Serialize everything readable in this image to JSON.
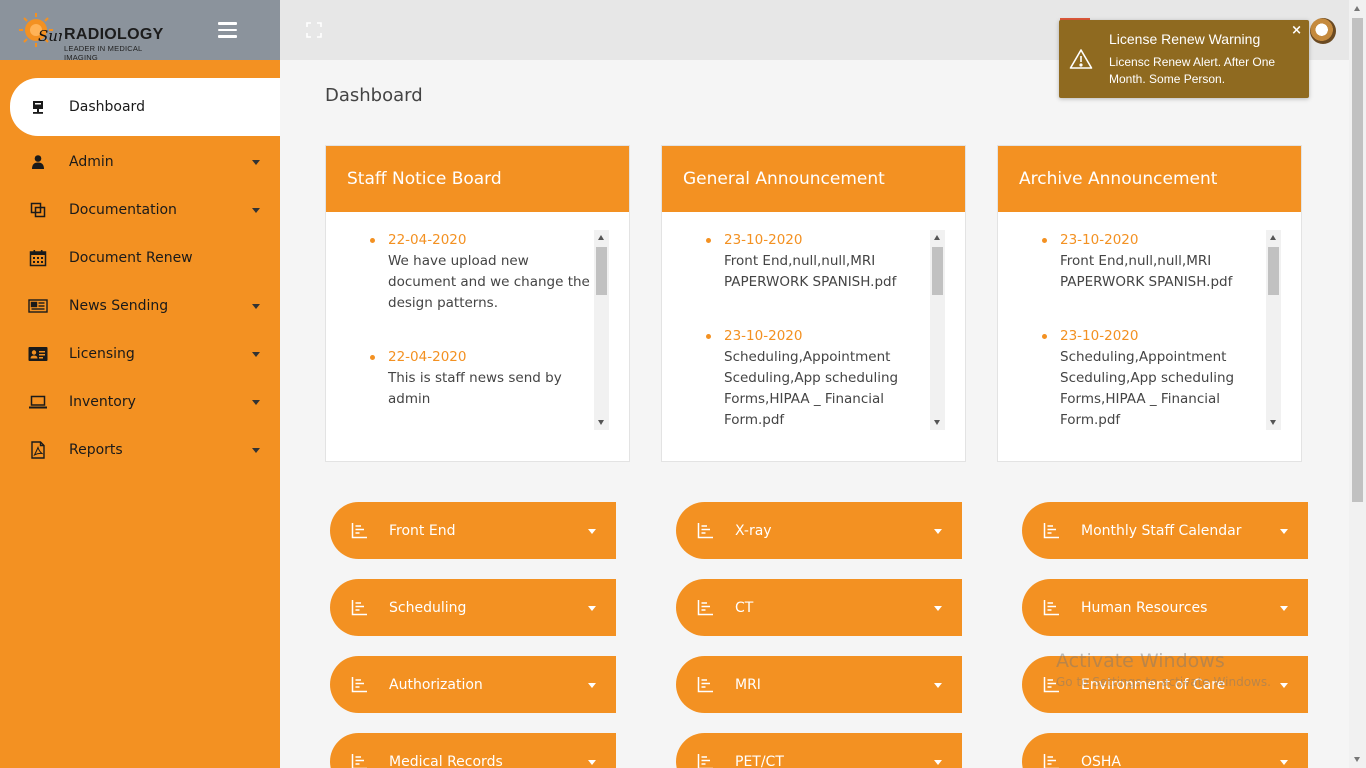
{
  "brand": {
    "logo_main": "RADIOLOGY",
    "logo_script": "Sun",
    "tagline": "LEADER IN MEDICAL IMAGING"
  },
  "sidebar": {
    "items": [
      {
        "label": "Dashboard",
        "icon": "monitor-icon",
        "active": true
      },
      {
        "label": "Admin",
        "icon": "user-icon"
      },
      {
        "label": "Documentation",
        "icon": "copy-icon"
      },
      {
        "label": "Document Renew",
        "icon": "calendar-icon"
      },
      {
        "label": "News Sending",
        "icon": "newspaper-icon"
      },
      {
        "label": "Licensing",
        "icon": "id-card-icon"
      },
      {
        "label": "Inventory",
        "icon": "laptop-icon"
      },
      {
        "label": "Reports",
        "icon": "pdf-file-icon"
      }
    ]
  },
  "toast": {
    "title": "License Renew Warning",
    "message": "Licensc Renew Alert. After One Month. Some Person.",
    "close": "×"
  },
  "page": {
    "title": "Dashboard"
  },
  "cards": [
    {
      "title": "Staff Notice Board",
      "items": [
        {
          "date": "22-04-2020",
          "text": "We have upload new document and we change the design patterns."
        },
        {
          "date": "22-04-2020",
          "text": "This is staff news send by admin"
        }
      ]
    },
    {
      "title": "General Announcement",
      "items": [
        {
          "date": "23-10-2020",
          "text": "Front End,null,null,MRI PAPERWORK SPANISH.pdf"
        },
        {
          "date": "23-10-2020",
          "text": "Scheduling,Appointment Sceduling,App scheduling Forms,HIPAA _ Financial Form.pdf"
        }
      ]
    },
    {
      "title": "Archive Announcement",
      "items": [
        {
          "date": "23-10-2020",
          "text": "Front End,null,null,MRI PAPERWORK SPANISH.pdf"
        },
        {
          "date": "23-10-2020",
          "text": "Scheduling,Appointment Sceduling,App scheduling Forms,HIPAA _ Financial Form.pdf"
        }
      ]
    }
  ],
  "categories": {
    "col1": [
      "Front End",
      "Scheduling",
      "Authorization",
      "Medical Records"
    ],
    "col2": [
      "X-ray",
      "CT",
      "MRI",
      "PET/CT"
    ],
    "col3": [
      "Monthly Staff Calendar",
      "Human Resources",
      "Environment of Care",
      "OSHA"
    ]
  },
  "watermark": {
    "line1": "Activate Windows",
    "line2": "Go to Settings to activate Windows."
  },
  "colors": {
    "accent": "#f39122",
    "topbar": "#8b939c",
    "toast": "#8f6a20"
  }
}
